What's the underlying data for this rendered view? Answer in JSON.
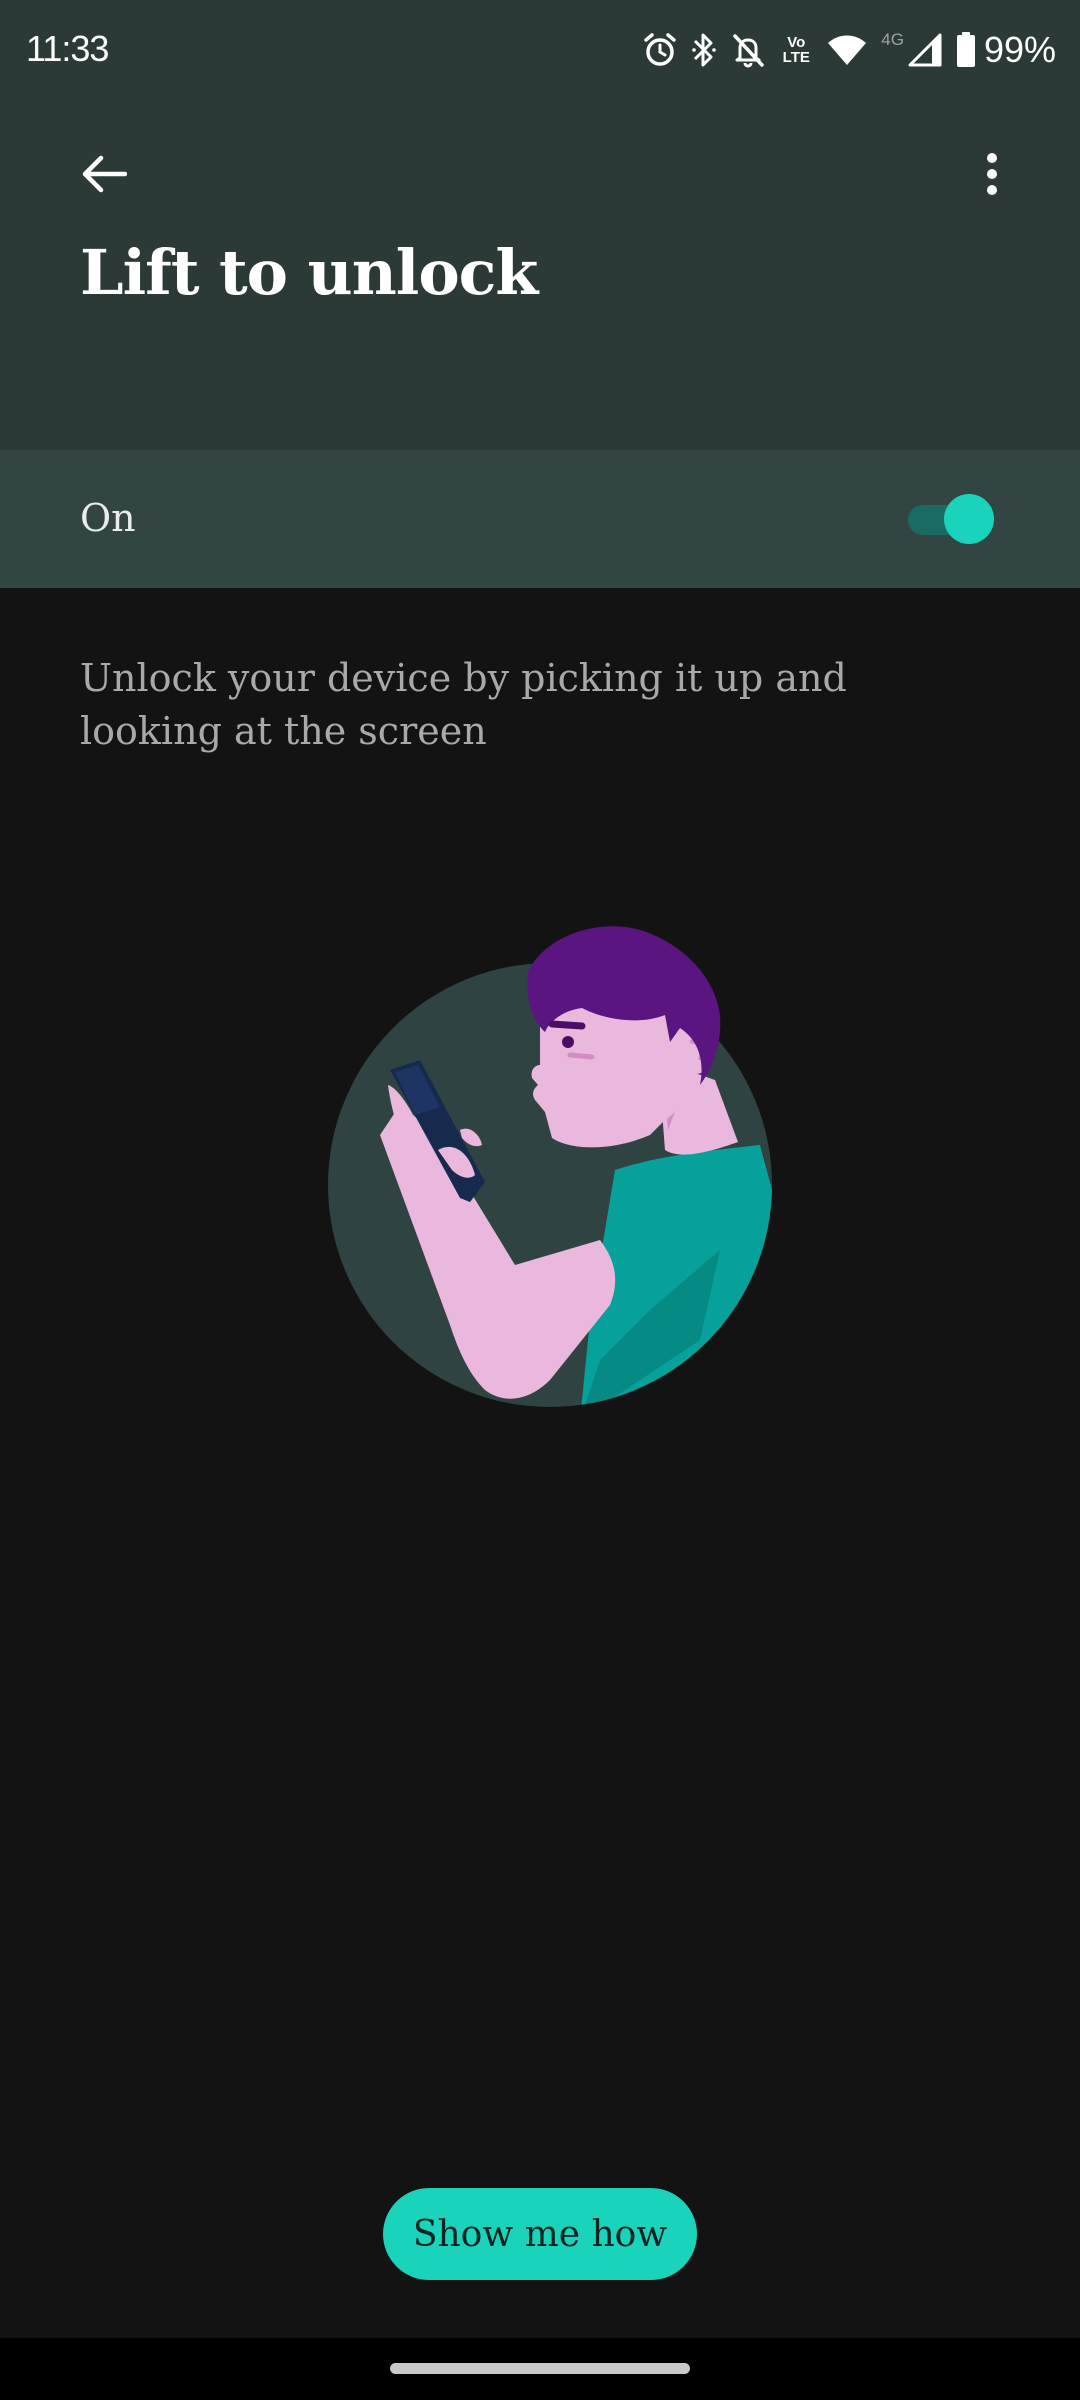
{
  "status_bar": {
    "time": "11:33",
    "network_volte": "Vo LTE",
    "network_type": "4G",
    "battery_percent": "99%",
    "icons": [
      "alarm-icon",
      "bluetooth-icon",
      "notifications-off-icon",
      "volte-icon",
      "wifi-icon",
      "signal-icon",
      "battery-icon"
    ]
  },
  "toolbar": {
    "back_icon": "arrow-back-icon",
    "more_icon": "more-vertical-icon",
    "title": "Lift to unlock"
  },
  "toggle": {
    "label": "On",
    "checked": true
  },
  "description": "Unlock your device by picking it up and looking at the screen",
  "illustration": {
    "subject": "person-looking-at-phone-illustration"
  },
  "action_button": {
    "label": "Show me how"
  },
  "colors": {
    "header_bg": "#2b3937",
    "toggle_row_bg": "#334543",
    "body_bg": "#131313",
    "accent": "#1ad3bb",
    "illustration_circle": "#2f4442",
    "hair": "#5a1580",
    "skin": "#e9b8dc",
    "shirt": "#06a19a",
    "phone": "#172a4d"
  }
}
